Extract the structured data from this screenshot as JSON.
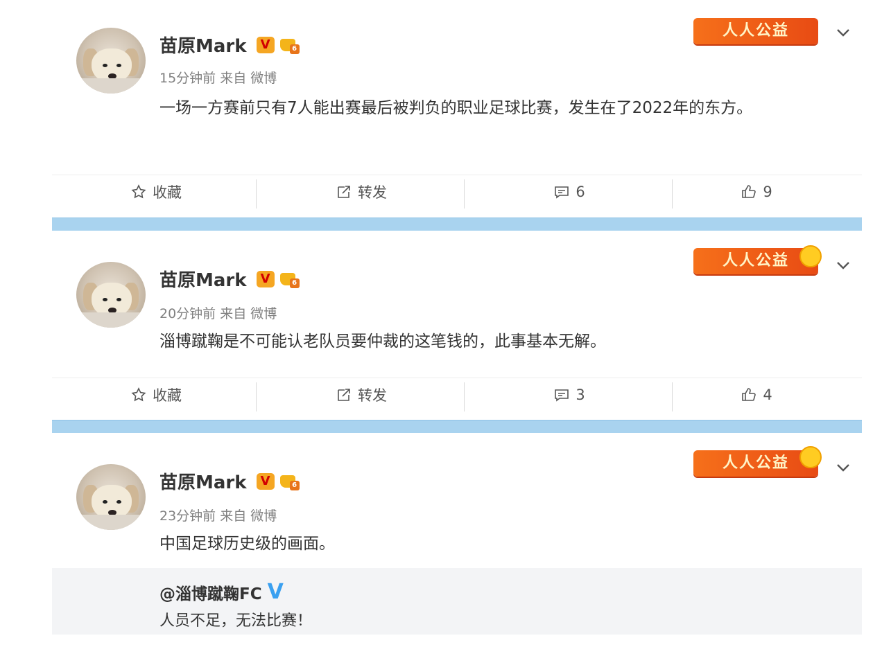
{
  "posts": [
    {
      "author": "苗原Mark",
      "v_badge": "V",
      "level": "6",
      "meta": "15分钟前 来自 微博",
      "text": "一场一方赛前只有7人能出赛最后被判负的职业足球比赛，发生在了2022年的东方。",
      "tag": "人人公益",
      "actions": {
        "favorite": "收藏",
        "repost": "转发",
        "comments": "6",
        "likes": "9"
      }
    },
    {
      "author": "苗原Mark",
      "v_badge": "V",
      "level": "6",
      "meta": "20分钟前 来自 微博",
      "text": "淄博蹴鞠是不可能认老队员要仲裁的这笔钱的，此事基本无解。",
      "tag": "人人公益",
      "actions": {
        "favorite": "收藏",
        "repost": "转发",
        "comments": "3",
        "likes": "4"
      }
    },
    {
      "author": "苗原Mark",
      "v_badge": "V",
      "level": "6",
      "meta": "23分钟前 来自 微博",
      "text": "中国足球历史级的画面。",
      "tag": "人人公益",
      "quoted": {
        "author": "@淄博蹴鞠FC",
        "v_badge": "V",
        "text": "人员不足，无法比赛！"
      }
    }
  ],
  "colors": {
    "separator_bar": "#a9d3ef",
    "tag_orange": "#f6701a",
    "verified_blue": "#3aa0f0"
  },
  "icons": [
    "star-icon",
    "share-icon",
    "comment-icon",
    "thumbs-up-icon",
    "chevron-down-icon"
  ]
}
